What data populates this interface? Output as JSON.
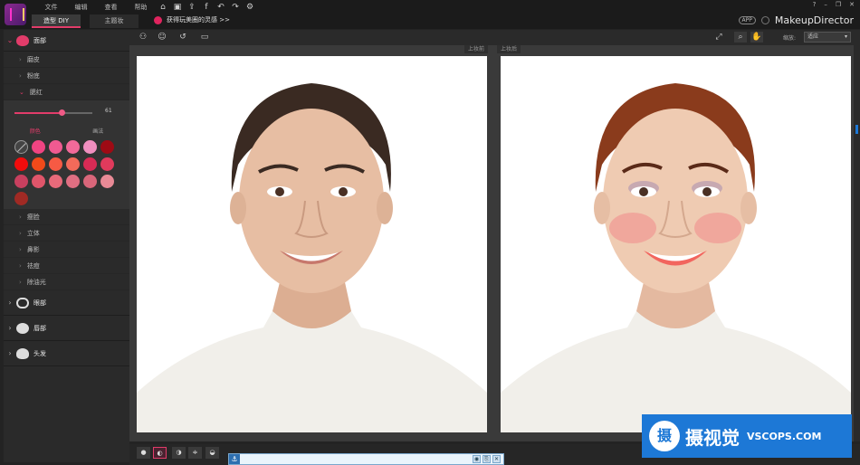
{
  "menu": [
    "文件",
    "编辑",
    "查看",
    "帮助"
  ],
  "mode_tabs": [
    {
      "label": "造型 DIY",
      "active": true
    },
    {
      "label": "主题妆",
      "active": false
    }
  ],
  "promo_text": "获得玩美圈的灵感 >>",
  "brand": {
    "app_badge": "APP",
    "name": "MakeupDirector"
  },
  "window_controls": [
    "?",
    "–",
    "❐",
    "✕"
  ],
  "left_panel": {
    "face_label": "面部",
    "face_items_before": [
      "磨皮",
      "粉底"
    ],
    "blush_label": "腮红",
    "blush_value": "61",
    "blush_level_percent": 61,
    "blush_tabs": [
      "颜色",
      "画法"
    ],
    "swatch_colors": [
      "none",
      "#f04482",
      "#f05a91",
      "#f26a9a",
      "#ef8fbf",
      "#9e0a14",
      "#f20c0c",
      "#f04a1a",
      "#f65a44",
      "#f26a5a",
      "#d72b55",
      "#e03a5c",
      "#c8405f",
      "#e0556a",
      "#e76a7a",
      "#e06f82",
      "#d9667a",
      "#e98a96",
      "#a02a24"
    ],
    "face_items_after": [
      "瘦脸",
      "立体",
      "鼻影",
      "祛痘",
      "除油光"
    ],
    "eye_label": "眼部",
    "lip_label": "唇部",
    "hair_label": "头发"
  },
  "toolbar": {
    "zoom_label": "缩放:",
    "zoom_value": "适应"
  },
  "view": {
    "before_label": "上妆前",
    "after_label": "上妆后"
  },
  "watermark": {
    "logo": "摄",
    "text": "摄视觉",
    "site": "VSCOPS.COM"
  }
}
